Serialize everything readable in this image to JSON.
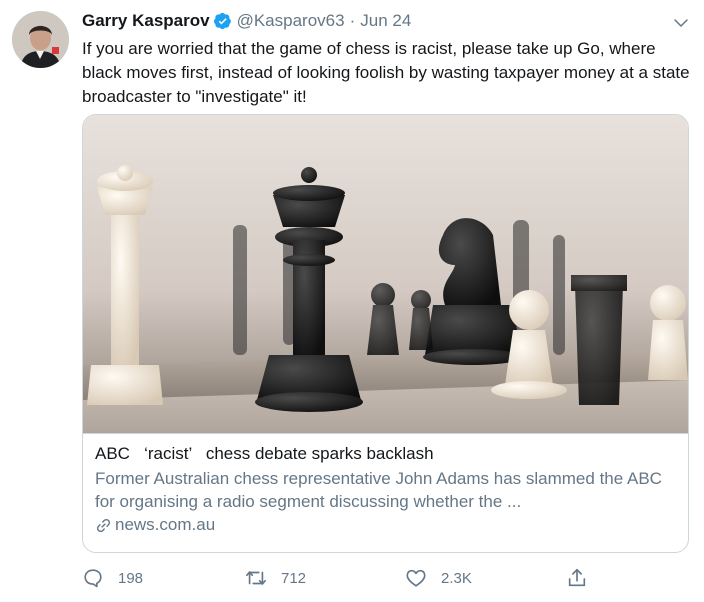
{
  "tweet": {
    "author_name": "Garry Kasparov",
    "handle": "@Kasparov63",
    "separator": "·",
    "date": "Jun 24",
    "text": "If you are worried that the game of chess is racist, please take up Go, where black moves first, instead of looking foolish by wasting taxpayer money at a state broadcaster to \"investigate\" it!"
  },
  "card": {
    "title": "ABC   ‘racist’   chess debate sparks backlash",
    "description": "Former Australian chess representative John Adams has slammed the ABC for organising a radio segment discussing whether the ...",
    "domain": "news.com.au",
    "image_subject": "chess pieces on a board"
  },
  "actions": {
    "replies": "198",
    "retweets": "712",
    "likes": "2.3K"
  },
  "colors": {
    "text": "#14171a",
    "secondary": "#657786",
    "verified": "#1da1f2",
    "border": "#ccd6dd"
  },
  "icons": [
    "verified-badge-icon",
    "chevron-down-icon",
    "link-icon",
    "reply-icon",
    "retweet-icon",
    "like-icon",
    "share-icon"
  ]
}
